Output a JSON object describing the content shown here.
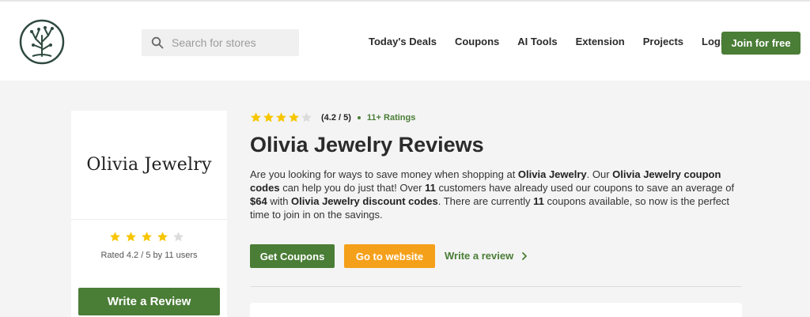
{
  "header": {
    "search_placeholder": "Search for stores",
    "nav": [
      "Today's Deals",
      "Coupons",
      "AI Tools",
      "Extension",
      "Projects",
      "Login"
    ],
    "join_label": "Join for free"
  },
  "store": {
    "brand_name": "Olivia Jewelry",
    "rating_stars_filled": 4,
    "rating_stars_total": 5,
    "rating_value_text": "(4.2 / 5)",
    "ratings_count": "11+ Ratings",
    "rated_text": "Rated 4.2 / 5 by 11 users",
    "write_review_label": "Write a Review"
  },
  "main": {
    "title": "Olivia Jewelry Reviews",
    "desc": {
      "p1": "Are you looking for ways to save money when shopping at ",
      "b1": "Olivia Jewelry",
      "p2": ". Our ",
      "b2": "Olivia Jewelry coupon codes",
      "p3": " can help you do just that! Over ",
      "b3": "11",
      "p4": " customers have already used our coupons to save an average of ",
      "b4": "$64",
      "p5": " with ",
      "b5": "Olivia Jewelry discount codes",
      "p6": ". There are currently ",
      "b6": "11",
      "p7": " coupons available, so now is the perfect time to join in on the savings."
    },
    "get_coupons_label": "Get Coupons",
    "go_to_website_label": "Go to website",
    "write_review_link": "Write a review"
  },
  "colors": {
    "accent_green": "#4a7d36",
    "accent_orange": "#f5a01a",
    "star_gold": "#f7c600",
    "star_empty": "#dcdcdc"
  }
}
